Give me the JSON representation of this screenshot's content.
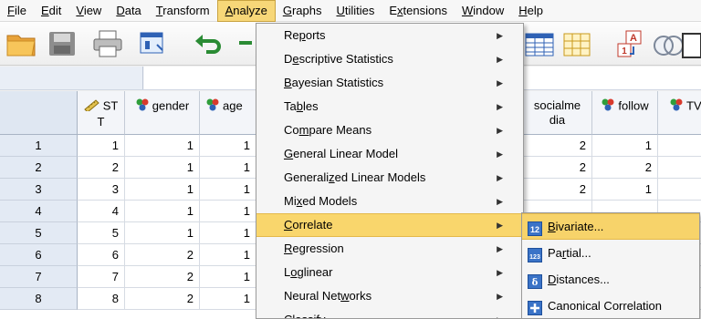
{
  "menubar": {
    "items": [
      {
        "label": "File",
        "u": "F",
        "rest": "ile"
      },
      {
        "label": "Edit",
        "u": "E",
        "rest": "dit"
      },
      {
        "label": "View",
        "u": "V",
        "rest": "iew"
      },
      {
        "label": "Data",
        "u": "D",
        "rest": "ata"
      },
      {
        "label": "Transform",
        "u": "T",
        "rest": "ransform"
      },
      {
        "label": "Analyze",
        "u": "A",
        "rest": "nalyze"
      },
      {
        "label": "Graphs",
        "u": "G",
        "rest": "raphs"
      },
      {
        "label": "Utilities",
        "u": "U",
        "rest": "tilities"
      },
      {
        "label": "Extensions",
        "pre": "E",
        "u": "x",
        "rest": "tensions"
      },
      {
        "label": "Window",
        "u": "W",
        "rest": "indow"
      },
      {
        "label": "Help",
        "u": "H",
        "rest": "elp"
      }
    ]
  },
  "grid": {
    "columns": [
      "ST T",
      "gender",
      "age",
      "socialme dia",
      "follow",
      "TV"
    ],
    "col1": [
      "ST",
      "T"
    ],
    "col_social": [
      "socialme",
      "dia"
    ],
    "rows": [
      {
        "n": "1",
        "st": "1",
        "gender": "1",
        "age": "1",
        "social": "2",
        "follow": "1"
      },
      {
        "n": "2",
        "st": "2",
        "gender": "1",
        "age": "1",
        "social": "2",
        "follow": "2"
      },
      {
        "n": "3",
        "st": "3",
        "gender": "1",
        "age": "1",
        "social": "2",
        "follow": "1"
      },
      {
        "n": "4",
        "st": "4",
        "gender": "1",
        "age": "1",
        "social": "",
        "follow": ""
      },
      {
        "n": "5",
        "st": "5",
        "gender": "1",
        "age": "1",
        "social": "",
        "follow": ""
      },
      {
        "n": "6",
        "st": "6",
        "gender": "2",
        "age": "1",
        "social": "",
        "follow": ""
      },
      {
        "n": "7",
        "st": "7",
        "gender": "2",
        "age": "1",
        "social": "",
        "follow": ""
      },
      {
        "n": "8",
        "st": "8",
        "gender": "2",
        "age": "1",
        "social": "",
        "follow": ""
      }
    ]
  },
  "analyze_menu": {
    "items": [
      {
        "label": "Reports",
        "pre": "Re",
        "u": "p",
        "rest": "orts",
        "submenu": true
      },
      {
        "label": "Descriptive Statistics",
        "pre": "D",
        "u": "e",
        "rest": "scriptive Statistics",
        "submenu": true
      },
      {
        "label": "Bayesian Statistics",
        "pre": "",
        "u": "B",
        "rest": "ayesian Statistics",
        "submenu": true
      },
      {
        "label": "Tables",
        "pre": "Ta",
        "u": "b",
        "rest": "les",
        "submenu": true
      },
      {
        "label": "Compare Means",
        "pre": "Co",
        "u": "m",
        "rest": "pare Means",
        "submenu": true
      },
      {
        "label": "General Linear Model",
        "pre": "",
        "u": "G",
        "rest": "eneral Linear Model",
        "submenu": true
      },
      {
        "label": "Generalized Linear Models",
        "pre": "Generali",
        "u": "z",
        "rest": "ed Linear Models",
        "submenu": true
      },
      {
        "label": "Mixed Models",
        "pre": "Mi",
        "u": "x",
        "rest": "ed Models",
        "submenu": true
      },
      {
        "label": "Correlate",
        "pre": "",
        "u": "C",
        "rest": "orrelate",
        "submenu": true,
        "highlighted": true
      },
      {
        "label": "Regression",
        "pre": "",
        "u": "R",
        "rest": "egression",
        "submenu": true
      },
      {
        "label": "Loglinear",
        "pre": "L",
        "u": "o",
        "rest": "glinear",
        "submenu": true
      },
      {
        "label": "Neural Networks",
        "pre": "Neural Net",
        "u": "w",
        "rest": "orks",
        "submenu": true
      },
      {
        "label": "Classify",
        "pre": "Classify",
        "u": "",
        "rest": "",
        "submenu": true
      }
    ]
  },
  "correlate_submenu": {
    "items": [
      {
        "label": "Bivariate...",
        "pre": "",
        "u": "B",
        "rest": "ivariate...",
        "icon": "bivariate-icon",
        "highlighted": true
      },
      {
        "label": "Partial...",
        "pre": "Pa",
        "u": "r",
        "rest": "tial...",
        "icon": "partial-icon"
      },
      {
        "label": "Distances...",
        "pre": "",
        "u": "D",
        "rest": "istances...",
        "icon": "distances-icon"
      },
      {
        "label": "Canonical Correlation",
        "pre": "Canonical Correlation",
        "u": "",
        "rest": "",
        "icon": "canonical-correlation-icon"
      }
    ]
  },
  "colors": {
    "menu_highlight": "#f9d66c",
    "row_header": "#e3eaf4"
  }
}
